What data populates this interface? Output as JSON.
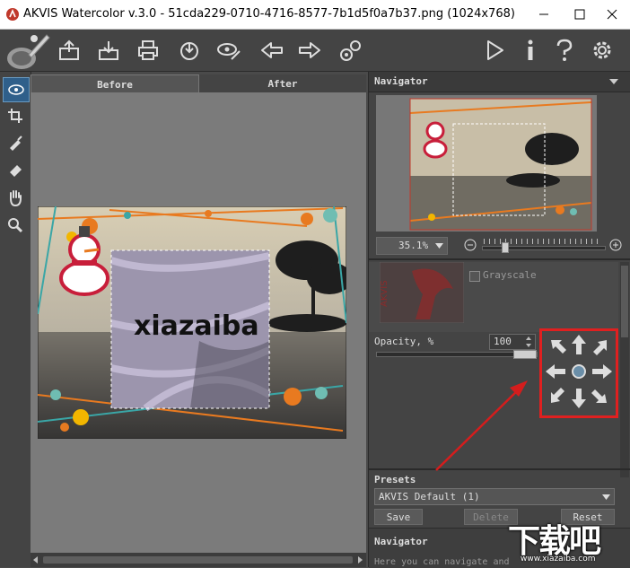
{
  "window": {
    "title": "AKVIS Watercolor v.3.0 - 51cda229-0710-4716-8577-7b1d5f0a7b37.png (1024x768)"
  },
  "tabs": {
    "before": "Before",
    "after": "After"
  },
  "canvas": {
    "watermark_text": "xiazaiba"
  },
  "navigator": {
    "title": "Navigator",
    "zoom": "35.1%"
  },
  "settings": {
    "grayscale_label": "Grayscale",
    "opacity_label": "Opacity, %",
    "opacity_value": "100"
  },
  "presets": {
    "title": "Presets",
    "selected": "AKVIS Default (1)",
    "save_label": "Save",
    "delete_label": "Delete",
    "reset_label": "Reset"
  },
  "help": {
    "title": "Navigator",
    "text": "Here you can navigate and"
  },
  "site_watermark": {
    "logo": "下载吧",
    "url": "www.xiazaiba.com"
  },
  "colors": {
    "highlight_box": "#e02020",
    "arrow": "#d41d1d",
    "panel_bg": "#444444",
    "canvas_bg": "#7b7b7b"
  }
}
